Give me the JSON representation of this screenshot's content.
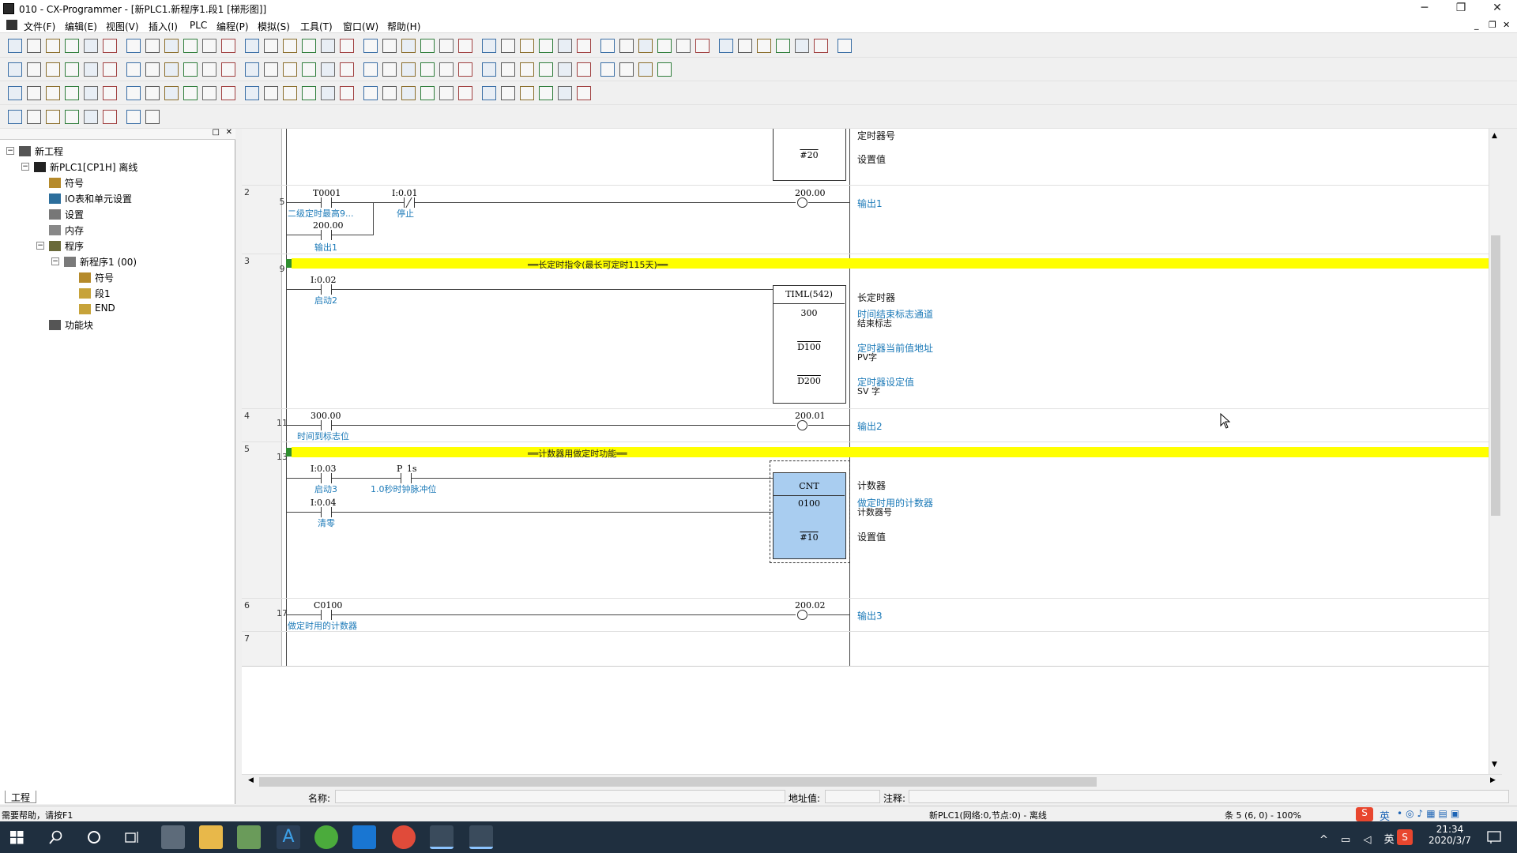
{
  "window": {
    "title": "010 - CX-Programmer - [新PLC1.新程序1.段1 [梯形图]]"
  },
  "menu": [
    "文件(F)",
    "编辑(E)",
    "视图(V)",
    "插入(I)",
    "PLC",
    "编程(P)",
    "模拟(S)",
    "工具(T)",
    "窗口(W)",
    "帮助(H)"
  ],
  "tree": {
    "items": [
      {
        "label": "新工程",
        "indent": 0,
        "toggle": "⊟",
        "icon": "project-icon"
      },
      {
        "label": "新PLC1[CP1H] 离线",
        "indent": 1,
        "toggle": "⊟",
        "icon": "plc-icon"
      },
      {
        "label": "符号",
        "indent": 2,
        "toggle": "",
        "icon": "symbols-icon"
      },
      {
        "label": "IO表和单元设置",
        "indent": 2,
        "toggle": "",
        "icon": "io-table-icon"
      },
      {
        "label": "设置",
        "indent": 2,
        "toggle": "",
        "icon": "settings-icon"
      },
      {
        "label": "内存",
        "indent": 2,
        "toggle": "",
        "icon": "memory-icon"
      },
      {
        "label": "程序",
        "indent": 2,
        "toggle": "⊟",
        "icon": "programs-icon"
      },
      {
        "label": "新程序1 (00)",
        "indent": 3,
        "toggle": "⊟",
        "icon": "program-icon"
      },
      {
        "label": "符号",
        "indent": 4,
        "toggle": "",
        "icon": "symbols-icon"
      },
      {
        "label": "段1",
        "indent": 4,
        "toggle": "",
        "icon": "section-icon"
      },
      {
        "label": "END",
        "indent": 4,
        "toggle": "",
        "icon": "section-icon"
      },
      {
        "label": "功能块",
        "indent": 2,
        "toggle": "",
        "icon": "function-block-icon"
      }
    ],
    "tab_label": "工程"
  },
  "ladder": {
    "rung_nums": [
      "2",
      "3",
      "4",
      "5",
      "6",
      "7"
    ],
    "step_nums": [
      "5",
      "9",
      "11",
      "13",
      "17"
    ],
    "top_partial": {
      "box_value": "#20",
      "side1": "定时器号",
      "side2": "设置值"
    },
    "rung2": {
      "c1_addr": "T0001",
      "c1_cmt": "二级定时最高9...",
      "c2_addr": "I:0.01",
      "c2_cmt": "停止",
      "c3_addr": "200.00",
      "c3_cmt": "输出1",
      "coil_addr": "200.00",
      "coil_cmt": "输出1"
    },
    "rung3": {
      "bar_text": "══长定时指令(最长可定时115天)══",
      "c1_addr": "I:0.02",
      "c1_cmt": "启动2",
      "box_title": "TIML(542)",
      "op1": "300",
      "op2": "D100",
      "op3": "D200",
      "side_title": "长定时器",
      "s1_c": "时间结束标志通道",
      "s1_b": "结束标志",
      "s2_c": "定时器当前值地址",
      "s2_b": "PV字",
      "s3_c": "定时器设定值",
      "s3_b": "SV 字"
    },
    "rung4": {
      "c1_addr": "300.00",
      "c1_cmt": "时间到标志位",
      "coil_addr": "200.01",
      "coil_cmt": "输出2"
    },
    "rung5": {
      "bar_text": "══计数器用做定时功能══",
      "c1_addr": "I:0.03",
      "c1_cmt": "启动3",
      "c2_addr": "P_1s",
      "c2_cmt": "1.0秒时钟脉冲位",
      "c3_addr": "I:0.04",
      "c3_cmt": "清零",
      "box_title": "CNT",
      "op1": "0100",
      "op2": "#10",
      "side_title": "计数器",
      "s1_c": "做定时用的计数器",
      "s1_b": "计数器号",
      "s2_b": "设置值"
    },
    "rung6": {
      "c1_addr": "C0100",
      "c1_cmt": "做定时用的计数器",
      "coil_addr": "200.02",
      "coil_cmt": "输出3"
    }
  },
  "bottom": {
    "name_label": "名称:",
    "addr_label": "地址值:",
    "note_label": "注释:"
  },
  "status": {
    "help": "需要帮助，请按F1",
    "plc": "新PLC1(网络:0,节点:0) - 离线",
    "pos": "条 5 (6, 0)  - 100%"
  },
  "tray": {
    "time": "21:34",
    "date": "2020/3/7",
    "ime": "英"
  },
  "colors": {
    "highlight_box": "#a9cdf0",
    "rung_bar": "#ffff00",
    "comment": "#1c7ab8"
  }
}
